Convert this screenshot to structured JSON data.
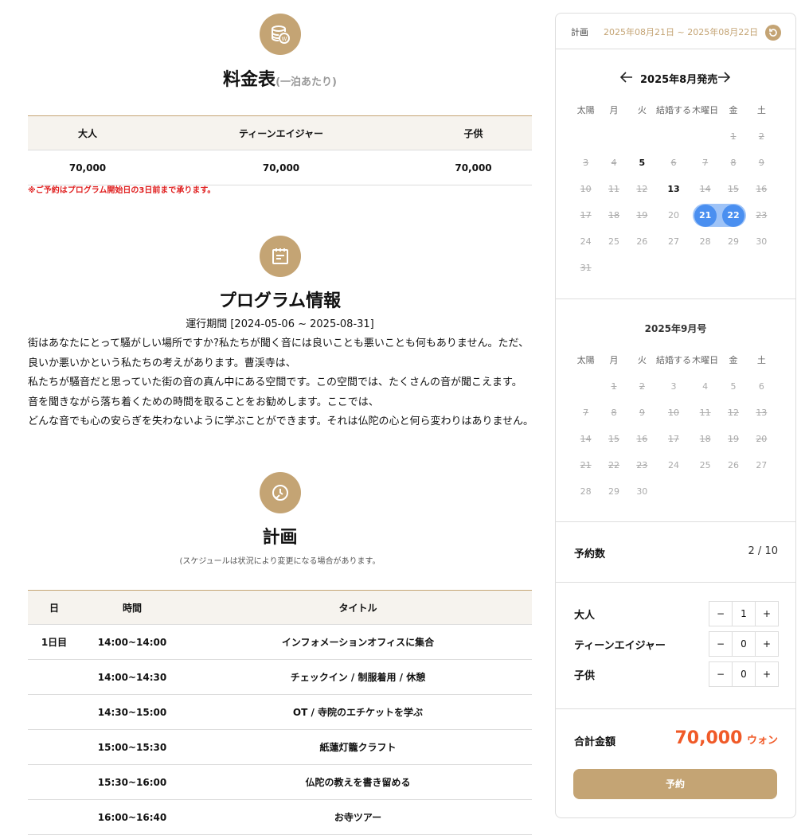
{
  "fees": {
    "title": "料金表",
    "title_note": "(一泊あたり)",
    "headers": [
      "大人",
      "ティーンエイジャー",
      "子供"
    ],
    "values": [
      "70,000",
      "70,000",
      "70,000"
    ],
    "note": "※ご予約はプログラム開始日の3日前まで承ります。"
  },
  "program": {
    "title": "プログラム情報",
    "period": "運行期間 [2024-05-06 ~ 2025-08-31]",
    "lines": [
      "街はあなたにとって騒がしい場所ですか?私たちが聞く音には良いことも悪いことも何もありません。ただ、",
      "良いか悪いかという私たちの考えがあります。曹渓寺は、",
      "私たちが騒音だと思っていた街の音の真ん中にある空間です。この空間では、たくさんの音が聞こえます。",
      "音を聞きながら落ち着くための時間を取ることをお勧めします。ここでは、",
      "どんな音でも心の安らぎを失わないように学ぶことができます。それは仏陀の心と何ら変わりはありません。"
    ]
  },
  "schedule": {
    "title": "計画",
    "note": "(スケジュールは状況により変更になる場合があります。",
    "headers": [
      "日",
      "時間",
      "タイトル"
    ],
    "rows": [
      {
        "day": "1日目",
        "time": "14:00~14:00",
        "title": "インフォメーションオフィスに集合"
      },
      {
        "day": "",
        "time": "14:00~14:30",
        "title": "チェックイン / 制服着用 / 休憩"
      },
      {
        "day": "",
        "time": "14:30~15:00",
        "title": "OT / 寺院のエチケットを学ぶ"
      },
      {
        "day": "",
        "time": "15:00~15:30",
        "title": "紙蓮灯籠クラフト"
      },
      {
        "day": "",
        "time": "15:30~16:00",
        "title": "仏陀の教えを書き留める"
      },
      {
        "day": "",
        "time": "16:00~16:40",
        "title": "お寺ツアー"
      }
    ]
  },
  "sidebar": {
    "plan_label": "計画",
    "plan_range": "2025年08月21日 ~ 2025年08月22日",
    "weekdays": [
      "太陽",
      "月",
      "火",
      "結婚する",
      "木曜日",
      "金",
      "土"
    ],
    "cal1": {
      "title": "2025年8月発売",
      "offset": 5,
      "days": 31,
      "available": [
        5,
        13
      ],
      "selected": [
        21,
        22
      ],
      "plain": [
        20,
        24,
        25,
        26,
        27,
        28,
        29,
        30
      ]
    },
    "cal2": {
      "title": "2025年9月号",
      "offset": 1,
      "days": 30,
      "available": [],
      "selected": [],
      "plain": [
        3,
        4,
        5,
        6,
        24,
        25,
        26,
        27,
        28,
        29,
        30
      ]
    },
    "reservations_label": "予約数",
    "reservations_value": "2 / 10",
    "adult_label": "大人",
    "adult_value": "1",
    "teen_label": "ティーンエイジャー",
    "teen_value": "0",
    "child_label": "子供",
    "child_value": "0",
    "total_label": "合計金額",
    "total_value": "70,000",
    "total_unit": "ウォン",
    "reserve_button": "予約"
  },
  "colors": {
    "accent": "#c4a474",
    "selected": "#4a8ff0",
    "price": "#f05a28",
    "warning": "#e02020"
  }
}
